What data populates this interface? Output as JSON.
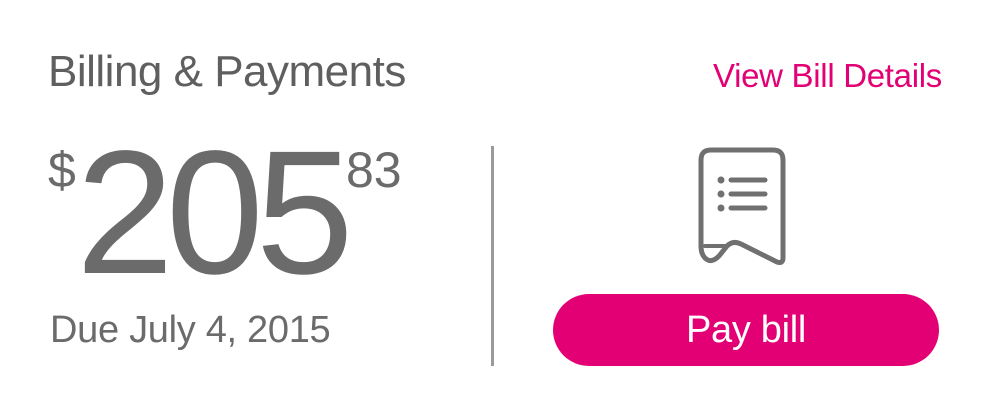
{
  "header": {
    "title": "Billing & Payments",
    "details_link": "View Bill Details"
  },
  "balance": {
    "currency": "$",
    "dollars": "205",
    "cents": "83",
    "due_text": "Due July 4, 2015"
  },
  "actions": {
    "pay_label": "Pay bill",
    "icon": "bill-document-icon"
  },
  "colors": {
    "accent": "#e20074",
    "text": "#666666",
    "divider": "#9a9a9a"
  }
}
